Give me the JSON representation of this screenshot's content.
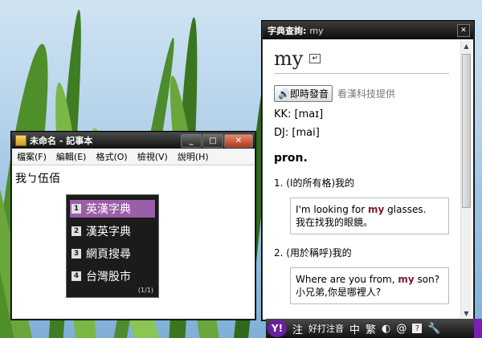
{
  "notepad": {
    "title": "未命名 - 記事本",
    "menu": [
      "檔案(F)",
      "編輯(E)",
      "格式(O)",
      "檢視(V)",
      "說明(H)"
    ],
    "text": "我ㄅ伍佰",
    "candidates": [
      {
        "num": "1",
        "label": "英漢字典"
      },
      {
        "num": "2",
        "label": "漢英字典"
      },
      {
        "num": "3",
        "label": "網頁搜尋"
      },
      {
        "num": "4",
        "label": "台灣股市"
      }
    ],
    "page_indicator": "(1/1)"
  },
  "dictionary": {
    "title": "字典查詢:",
    "query": "my",
    "word": "my",
    "speak_label": "即時發音",
    "provider": "看漢科技提供",
    "kk_label": "KK: [",
    "kk_value": "maɪ",
    "kk_close": "]",
    "dj_label": "DJ: [",
    "dj_value": "mai",
    "dj_close": "]",
    "pos": "pron.",
    "definitions": [
      {
        "label": "1. (I的所有格)我的",
        "example_pre": "I'm looking for ",
        "example_hl": "my",
        "example_post": " glasses.",
        "translation": "我在找我的眼鏡。"
      },
      {
        "label": "2. (用於稱呼)我的",
        "example_pre": "Where are you from, ",
        "example_hl": "my",
        "example_post": " son?",
        "translation": "小兄弟,你是哪裡人?"
      }
    ]
  },
  "ime": {
    "logo": "Y!",
    "mode": "注",
    "name": "好打注音",
    "zh": "中",
    "trad": "繁"
  }
}
